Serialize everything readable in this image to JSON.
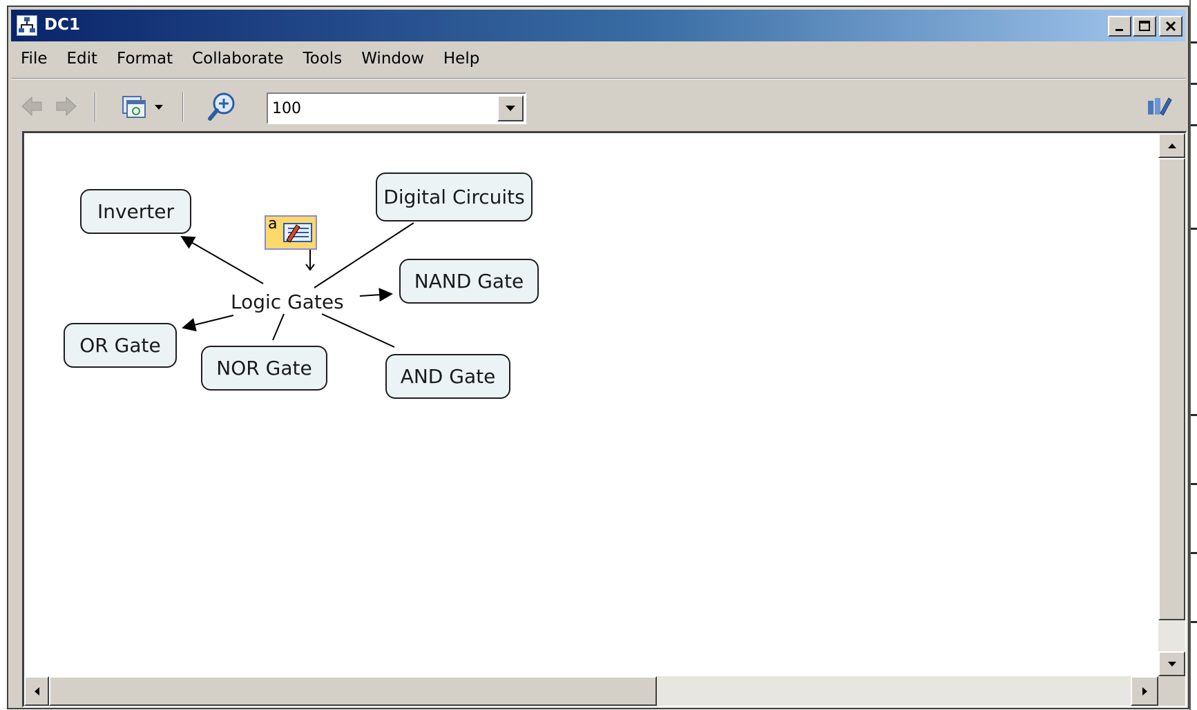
{
  "window": {
    "title": "DC1",
    "controls": [
      "minimize",
      "maximize",
      "close"
    ]
  },
  "menubar": {
    "items": [
      "File",
      "Edit",
      "Format",
      "Collaborate",
      "Tools",
      "Window",
      "Help"
    ]
  },
  "toolbar": {
    "back_icon": "back-arrow-icon",
    "forward_icon": "forward-arrow-icon",
    "view_icon": "view-options-icon",
    "zoom_icon": "zoom-icon",
    "zoom_value": "100",
    "edit_icon": "edit-style-icon"
  },
  "concept_map": {
    "center": "Logic Gates",
    "concepts": {
      "inverter": "Inverter",
      "digital_circuits": "Digital Circuits",
      "nand": "NAND Gate",
      "or": "OR Gate",
      "nor": "NOR Gate",
      "and": "AND Gate"
    },
    "edit_handle_letter": "a"
  },
  "colors": {
    "title_start": "#0a246a",
    "title_end": "#a6caf0",
    "chrome": "#d4d0c8",
    "concept_fill": "#ebf3f5",
    "handle_fill": "#fdd86a"
  }
}
